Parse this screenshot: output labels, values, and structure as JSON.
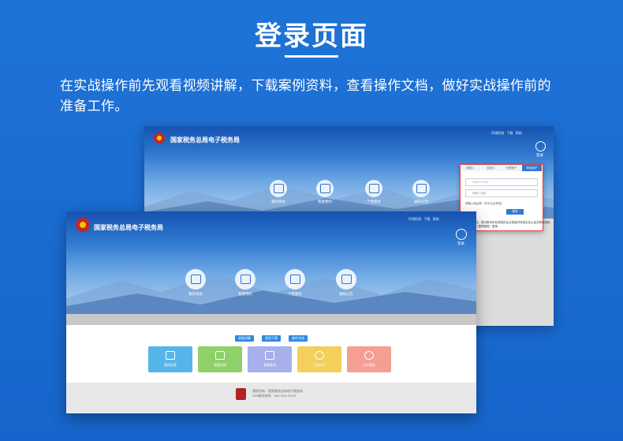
{
  "page": {
    "title": "登录页面",
    "description": "在实战操作前先观看视频讲解，下载案例资料，查看操作文档，做好实战操作前的准备工作。"
  },
  "portal": {
    "name": "国家税务总局电子税务局",
    "top_links": [
      "环境检测",
      "下载",
      "帮助"
    ],
    "login_label": "登录",
    "services": [
      "我的待办",
      "我要预约",
      "个性服务",
      "通知公告"
    ]
  },
  "login_popup": {
    "tabs": [
      "纳税人",
      "自然人",
      "代理用户",
      "特派用户"
    ],
    "fields": [
      "9151****XXX",
      "请输入密码"
    ],
    "remember": "请输入验证码（本次认证有效）",
    "submit": "登录",
    "note": "注：提示账号存在风险的企业请及时完成实名认证并修改密码（暂停使用）登录。"
  },
  "front": {
    "tag_buttons": [
      "视频讲解",
      "案例下载",
      "操作文档"
    ],
    "tiles": [
      {
        "label": "我的信息",
        "color": "#56b5e8"
      },
      {
        "label": "我要办税",
        "color": "#8fd06a"
      },
      {
        "label": "我要查询",
        "color": "#a6b0ea"
      },
      {
        "label": "互动中心",
        "color": "#f4cf5c"
      },
      {
        "label": "公众服务",
        "color": "#f49f91"
      }
    ],
    "footer_lines": [
      "版权所有：国家税务总局电子税务局",
      "24H服务热线：400-XXX-XXXX"
    ]
  }
}
